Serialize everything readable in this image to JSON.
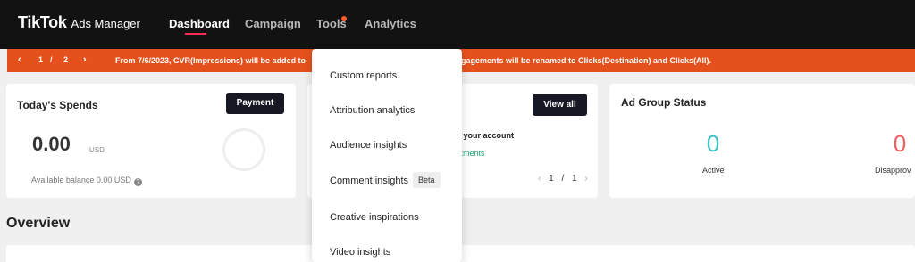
{
  "header": {
    "logo_main": "TikTok",
    "logo_sub": "Ads Manager",
    "nav": [
      "Dashboard",
      "Campaign",
      "Tools",
      "Analytics"
    ],
    "active": "Dashboard"
  },
  "banner": {
    "page_current": "1",
    "page_sep": "/",
    "page_total": "2",
    "message_start": "From 7/6/2023, CVR(Impressions) will be added to",
    "message_end": "gagements will be renamed to Clicks(Destination) and Clicks(All)."
  },
  "spends": {
    "title": "Today's Spends",
    "payment_label": "Payment",
    "amount": "0.00",
    "currency": "USD",
    "balance": "Available balance 0.00 USD"
  },
  "tips": {
    "view_all_label": "View all",
    "text": "e your account",
    "link": "stments",
    "page_current": "1",
    "page_sep": "/",
    "page_total": "1"
  },
  "ad_group_status": {
    "title": "Ad Group Status",
    "active_count": "0",
    "active_label": "Active",
    "disapproved_count": "0",
    "disapproved_label": "Disapprov"
  },
  "overview": {
    "title": "Overview"
  },
  "tools_menu": {
    "items": [
      "Custom reports",
      "Attribution analytics",
      "Audience insights",
      "Comment insights",
      "Creative inspirations",
      "Video insights"
    ],
    "beta_label": "Beta"
  },
  "colors": {
    "topbar": "#121212",
    "banner": "#e5511d",
    "accent": "#fe2c55",
    "active_status": "#3cc2c2",
    "disapproved_status": "#f0605e",
    "link": "#1aab6c"
  }
}
